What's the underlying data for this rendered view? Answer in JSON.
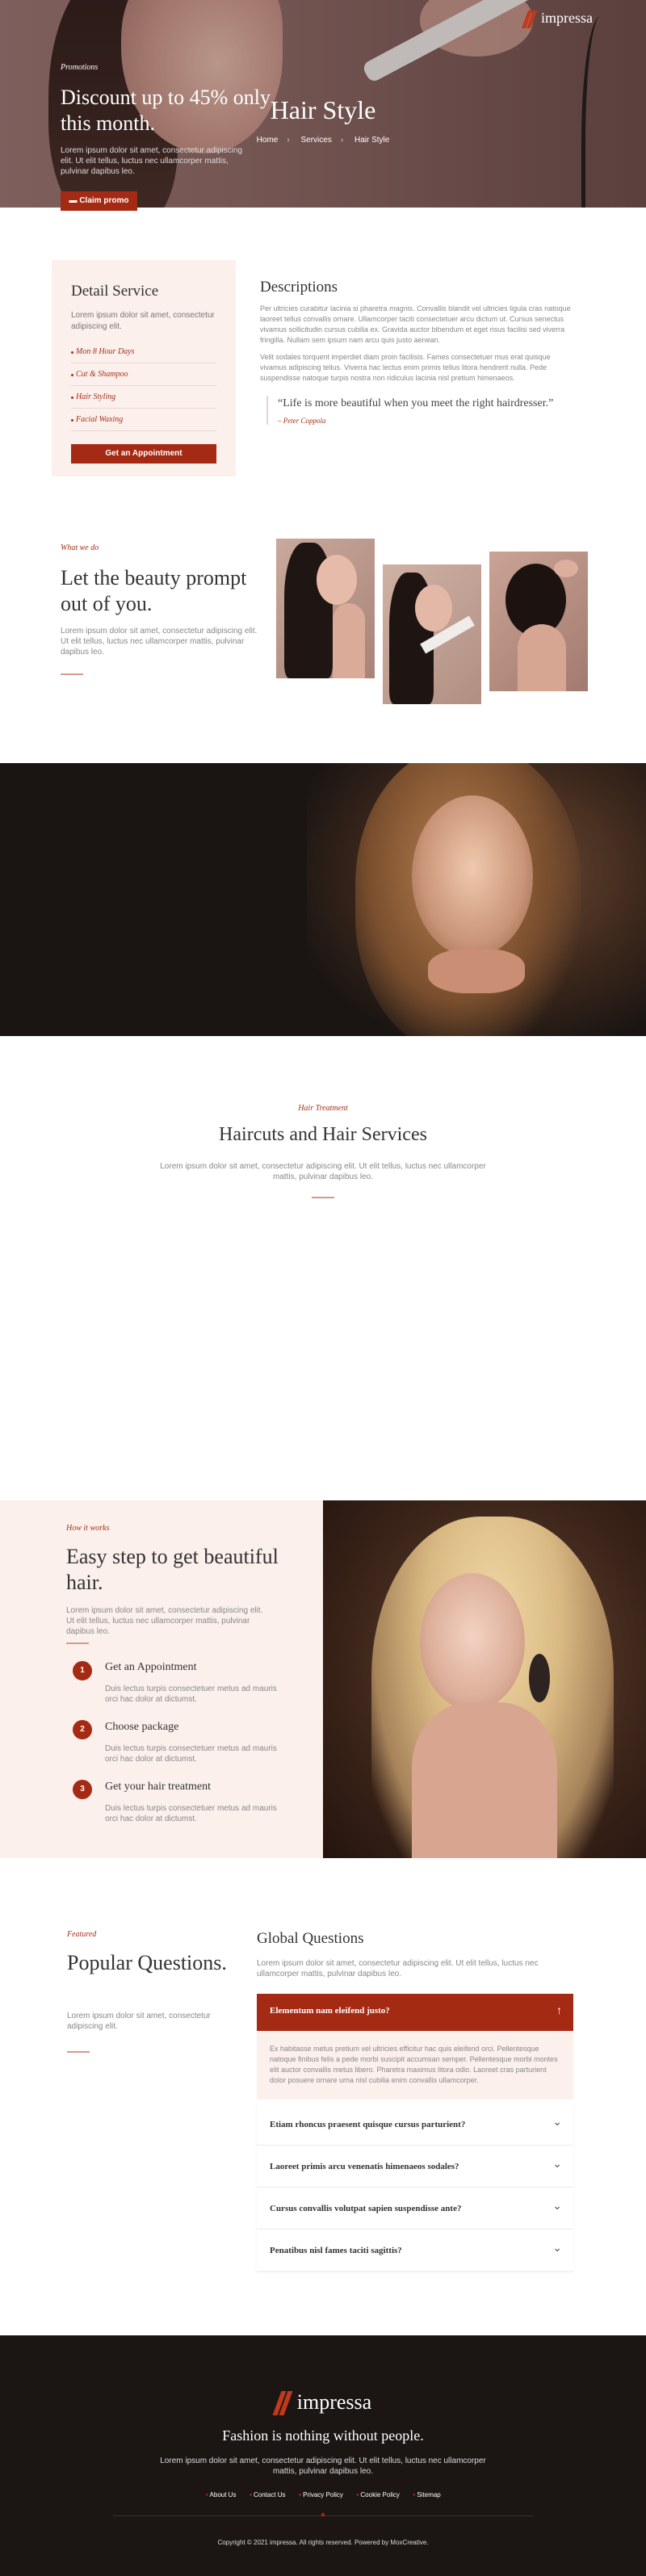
{
  "brand": {
    "name": "impressa",
    "accent": "#a52a14",
    "dark": "#1b1614",
    "blush": "#fbf0ec"
  },
  "hero": {
    "title": "Hair Style",
    "breadcrumb": [
      "Home",
      "Services",
      "Hair Style"
    ]
  },
  "detail": {
    "title": "Detail Service",
    "description": "Lorem ipsum dolor sit amet, consectetur adipiscing elit.",
    "items": [
      "Mon 8 Hour Days",
      "Cut & Shampoo",
      "Hair Styling",
      "Facial Waxing"
    ],
    "button": "Get an Appointment"
  },
  "descriptions": {
    "title": "Descriptions",
    "p1": "Per ultricies curabitur lacinia si pharetra magnis. Convallis blandit vel ultricies ligula cras natoque laoreet tellus convallis ornare. Ullamcorper taciti consectetuer arcu dictum ut. Cursus senectus vivamus sollicitudin cursus cubilia ex. Gravida auctor bibendum et eget risus facilisi sed viverra fringilla. Nullam sem ipsum nam arcu quis justo aenean.",
    "p2": "Velit sodales torquent imperdiet diam proin facilisis. Fames consectetuer mus erat quisque vivamus adipiscing tellus. Viverra hac lectus enim primis tellus litora hendrerit nulla. Pede suspendisse natoque turpis nostra non ridiculus lacinia nisl pretium himenaeos.",
    "quote": "“Life is more beautiful when you meet the right hairdresser.”",
    "quote_author": "– Peter Coppola"
  },
  "what_we_do": {
    "eyebrow": "What we do",
    "title": "Let the beauty prompt out of you.",
    "text": "Lorem ipsum dolor sit amet, consectetur adipiscing elit. Ut elit tellus, luctus nec ullamcorper mattis, pulvinar dapibus leo."
  },
  "promo": {
    "eyebrow": "Promotions",
    "title": "Discount up to 45% only this month.",
    "text": "Lorem ipsum dolor sit amet, consectetur adipiscing elit. Ut elit tellus, luctus nec ullamcorper mattis, pulvinar dapibus leo.",
    "button": "Claim promo"
  },
  "haircuts": {
    "eyebrow": "Hair Treatment",
    "title": "Haircuts and Hair Services",
    "text": "Lorem ipsum dolor sit amet, consectetur adipiscing elit. Ut elit tellus, luctus nec ullamcorper mattis, pulvinar dapibus leo."
  },
  "steps": {
    "eyebrow": "How it works",
    "title": "Easy step to get beautiful hair.",
    "text": "Lorem ipsum dolor sit amet, consectetur adipiscing elit. Ut elit tellus, luctus nec ullamcorper mattis, pulvinar dapibus leo.",
    "items": [
      {
        "num": "1",
        "title": "Get an Appointment",
        "text": "Duis lectus turpis consectetuer metus ad mauris orci hac dolor at dictumst."
      },
      {
        "num": "2",
        "title": "Choose package",
        "text": "Duis lectus turpis consectetuer metus ad mauris orci hac dolor at dictumst."
      },
      {
        "num": "3",
        "title": "Get your hair treatment",
        "text": "Duis lectus turpis consectetuer metus ad mauris orci hac dolor at dictumst."
      }
    ]
  },
  "faq": {
    "eyebrow": "Featured",
    "title": "Popular Questions.",
    "text": "Lorem ipsum dolor sit amet, consectetur adipiscing elit.",
    "global_title": "Global Questions",
    "global_text": "Lorem ipsum dolor sit amet, consectetur adipiscing elit. Ut elit tellus, luctus nec ullamcorper mattis, pulvinar dapibus leo.",
    "open_question": "Elementum nam eleifend justo?",
    "open_answer": "Ex habitasse metus pretium vel ultricies efficitur hac quis eleifend orci. Pellentesque natoque finibus felis a pede morbi suscipit accumsan semper. Pellentesque morbi montes elit auctor convallis metus libero. Pharetra maximus litora odio. Laoreet cras parturient dolor posuere ornare urna nisl cubilia enim convallis ullamcorper.",
    "questions": [
      "Etiam rhoncus praesent quisque cursus parturient?",
      "Laoreet primis arcu venenatis himenaeos sodales?",
      "Cursus convallis volutpat sapien suspendisse ante?",
      "Penatibus nisl fames taciti sagittis?"
    ]
  },
  "footer": {
    "tagline": "Fashion is nothing without people.",
    "text": "Lorem ipsum dolor sit amet, consectetur adipiscing elit. Ut elit tellus, luctus nec ullamcorper mattis, pulvinar dapibus leo.",
    "links": [
      "About Us",
      "Contact Us",
      "Privacy Policy",
      "Cookie Policy",
      "Sitemap"
    ],
    "copyright": "Copyright © 2021 impressa. All rights reserved. Powered by MoxCreative."
  }
}
